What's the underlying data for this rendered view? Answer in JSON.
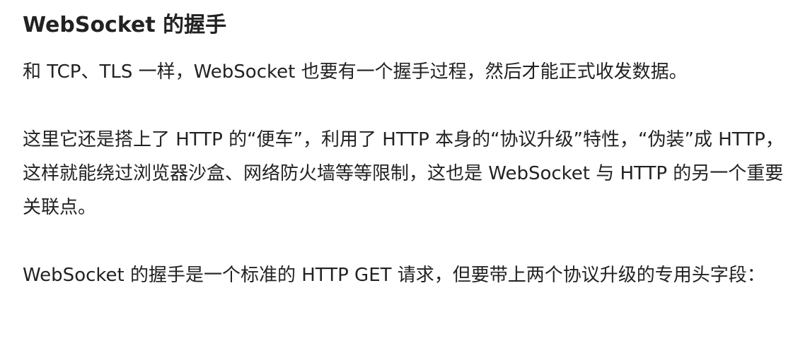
{
  "article": {
    "title": "WebSocket 的握手",
    "paragraphs": [
      "和 TCP、TLS 一样，WebSocket 也要有一个握手过程，然后才能正式收发数据。",
      "这里它还是搭上了 HTTP 的“便车”，利用了 HTTP 本身的“协议升级”特性，“伪装”成 HTTP，这样就能绕过浏览器沙盒、网络防火墙等等限制，这也是 WebSocket 与 HTTP 的另一个重要关联点。",
      "WebSocket 的握手是一个标准的 HTTP GET 请求，但要带上两个协议升级的专用头字段："
    ]
  }
}
